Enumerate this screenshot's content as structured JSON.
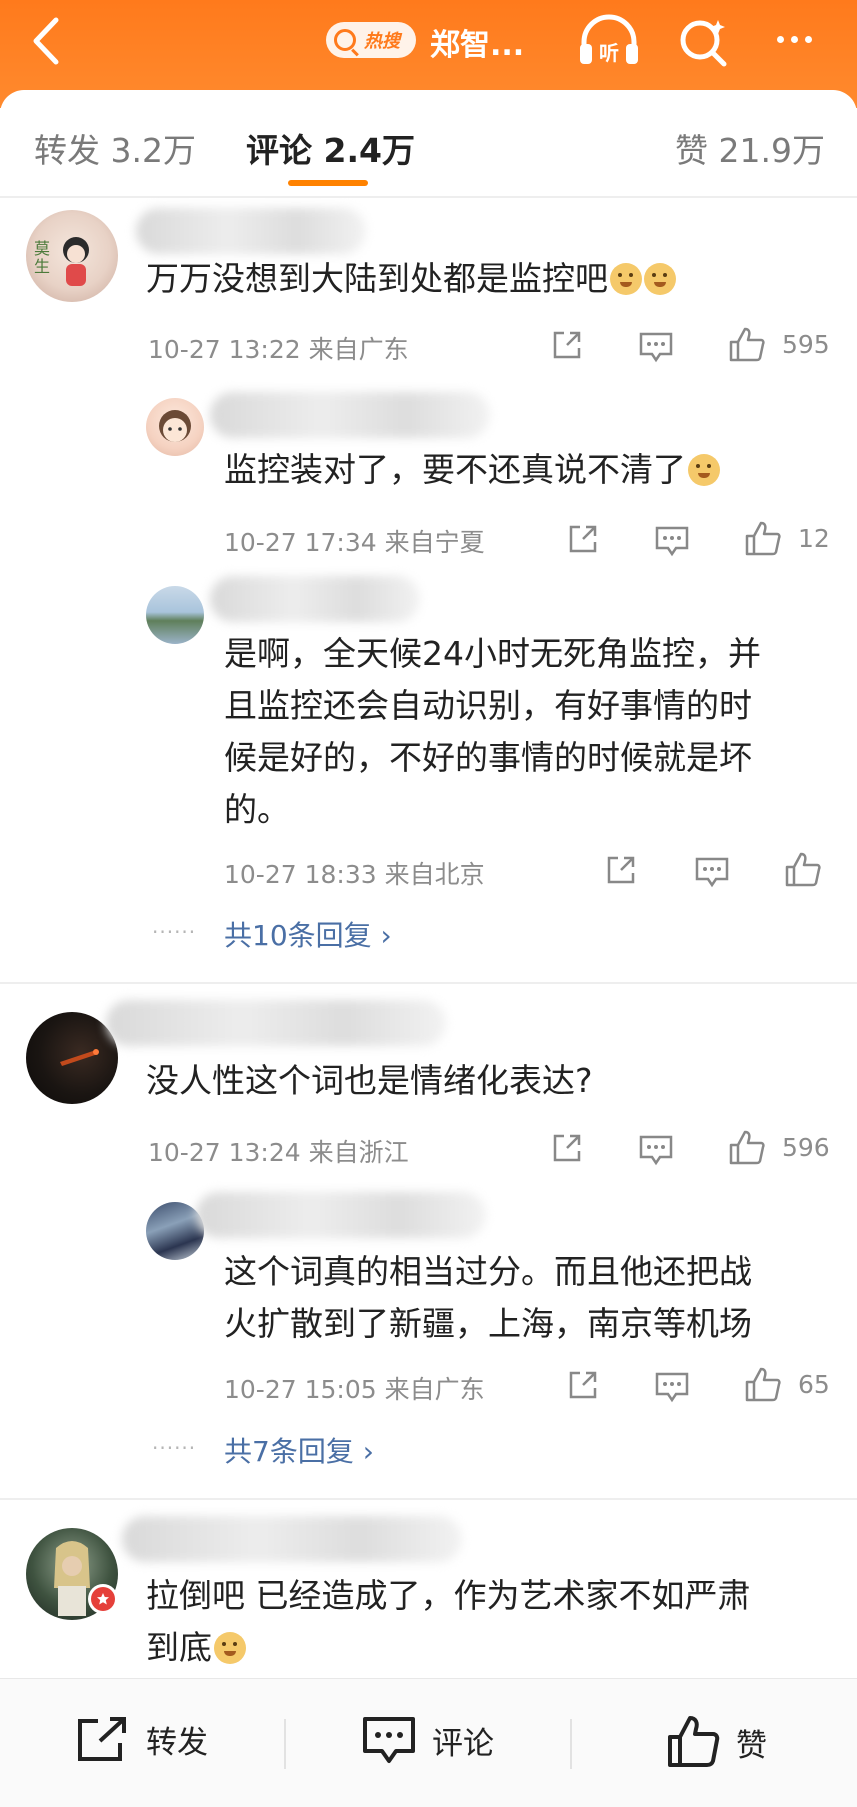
{
  "header": {
    "hot_search_label": "热搜",
    "title": "郑智...",
    "colors": {
      "accent": "#ff7a1c",
      "link": "#4a6fa5"
    }
  },
  "tabs": {
    "repost": "转发 3.2万",
    "comment": "评论 2.4万",
    "like": "赞 21.9万"
  },
  "comments": [
    {
      "text": "万万没想到大陆到处都是监控吧",
      "time": "10-27 13:22",
      "location": "来自广东",
      "likes": "595",
      "replies": [
        {
          "text": "监控装对了，要不还真说不清了",
          "time": "10-27 17:34",
          "location": "来自宁夏",
          "likes": "12"
        },
        {
          "text_lines": [
            "是啊，全天候24小时无死角监控，并",
            "且监控还会自动识别，有好事情的时",
            "候是好的，不好的事情的时候就是坏",
            "的。"
          ],
          "time": "10-27 18:33",
          "location": "来自北京",
          "likes": ""
        }
      ],
      "more_replies": "共10条回复 ›"
    },
    {
      "text": "没人性这个词也是情绪化表达?",
      "time": "10-27 13:24",
      "location": "来自浙江",
      "likes": "596",
      "replies": [
        {
          "text_lines": [
            "这个词真的相当过分。而且他还把战",
            "火扩散到了新疆，上海，南京等机场"
          ],
          "time": "10-27 15:05",
          "location": "来自广东",
          "likes": "65"
        }
      ],
      "more_replies": "共7条回复 ›"
    },
    {
      "text_lines": [
        "拉倒吧 已经造成了，作为艺术家不如严肃",
        "到底"
      ]
    }
  ],
  "bottom_bar": {
    "repost": "转发",
    "comment": "评论",
    "like": "赞"
  }
}
